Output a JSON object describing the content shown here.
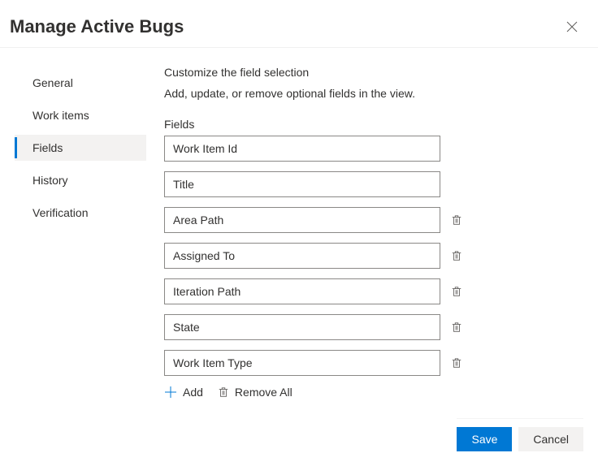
{
  "header": {
    "title": "Manage Active Bugs"
  },
  "sidebar": {
    "items": [
      {
        "label": "General"
      },
      {
        "label": "Work items"
      },
      {
        "label": "Fields"
      },
      {
        "label": "History"
      },
      {
        "label": "Verification"
      }
    ],
    "activeIndex": 2
  },
  "main": {
    "heading": "Customize the field selection",
    "subheading": "Add, update, or remove optional fields in the view.",
    "fields_label": "Fields",
    "fields": [
      {
        "label": "Work Item Id",
        "removable": false
      },
      {
        "label": "Title",
        "removable": false
      },
      {
        "label": "Area Path",
        "removable": true
      },
      {
        "label": "Assigned To",
        "removable": true
      },
      {
        "label": "Iteration Path",
        "removable": true
      },
      {
        "label": "State",
        "removable": true
      },
      {
        "label": "Work Item Type",
        "removable": true
      }
    ],
    "add_label": "Add",
    "remove_all_label": "Remove All"
  },
  "footer": {
    "save_label": "Save",
    "cancel_label": "Cancel"
  }
}
